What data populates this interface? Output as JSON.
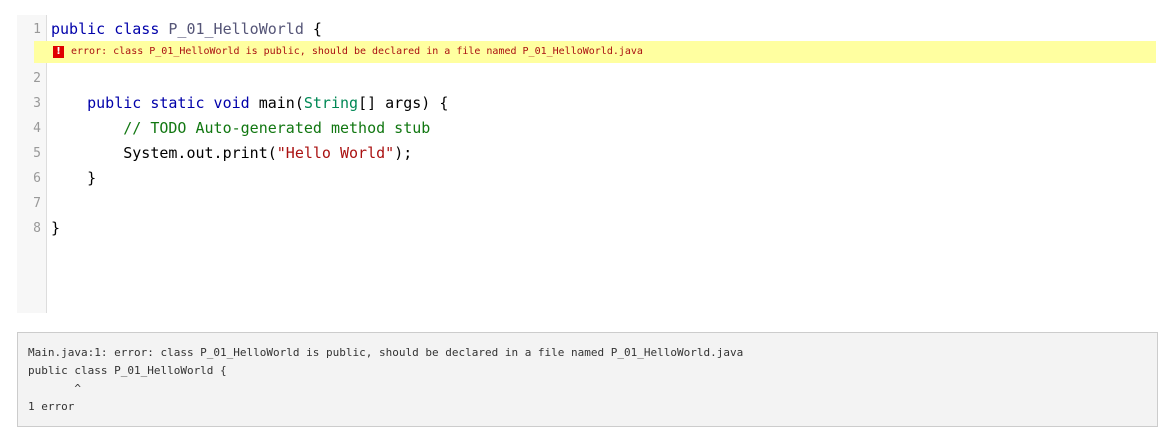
{
  "editor": {
    "lines": [
      {
        "num": "1",
        "tokens": [
          {
            "t": "public class ",
            "c": "kw"
          },
          {
            "t": "P_01_HelloWorld",
            "c": "def"
          },
          {
            "t": " {",
            "c": ""
          }
        ]
      },
      {
        "num": "2",
        "tokens": []
      },
      {
        "num": "3",
        "tokens": [
          {
            "t": "    public static void ",
            "c": "kw"
          },
          {
            "t": "main(",
            "c": ""
          },
          {
            "t": "String",
            "c": "type"
          },
          {
            "t": "[] args) {",
            "c": ""
          }
        ]
      },
      {
        "num": "4",
        "tokens": [
          {
            "t": "        // TODO Auto-generated method stub",
            "c": "comment"
          }
        ]
      },
      {
        "num": "5",
        "tokens": [
          {
            "t": "        System.out.print(",
            "c": ""
          },
          {
            "t": "\"Hello World\"",
            "c": "str"
          },
          {
            "t": ");",
            "c": ""
          }
        ]
      },
      {
        "num": "6",
        "tokens": [
          {
            "t": "    }",
            "c": ""
          }
        ]
      },
      {
        "num": "7",
        "tokens": []
      },
      {
        "num": "8",
        "tokens": [
          {
            "t": "}",
            "c": ""
          }
        ]
      }
    ],
    "error_widget": {
      "icon": "!",
      "message": "error: class P_01_HelloWorld is public, should be declared in a file named P_01_HelloWorld.java"
    }
  },
  "console": {
    "lines": [
      "Main.java:1: error: class P_01_HelloWorld is public, should be declared in a file named P_01_HelloWorld.java",
      "public class P_01_HelloWorld {",
      "       ^",
      "1 error"
    ]
  },
  "colors": {
    "keyword": "#0000aa",
    "definition": "#555577",
    "type": "#008855",
    "comment": "#117711",
    "string": "#aa1111",
    "error_background": "#ffffa0",
    "error_icon": "#e00000"
  }
}
